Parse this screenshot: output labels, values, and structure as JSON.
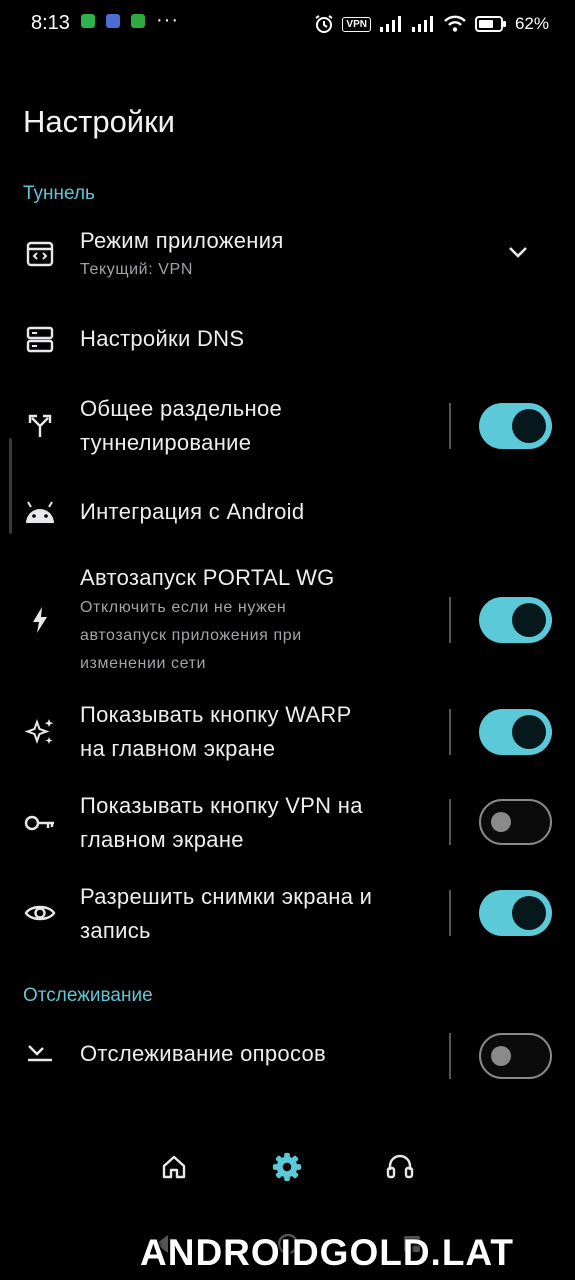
{
  "status_bar": {
    "time": "8:13",
    "dots": "···",
    "vpn_label": "VPN",
    "battery_percent": "62%",
    "icons": [
      "whatsapp-icon",
      "app-icon",
      "app-icon",
      "alarm-icon",
      "vpn-icon",
      "signal-icon",
      "signal-icon",
      "wifi-icon",
      "battery-icon"
    ]
  },
  "header": {
    "title": "Настройки"
  },
  "sections": {
    "tunnel": "Туннель",
    "tracking": "Отслеживание"
  },
  "rows": {
    "app_mode": {
      "title": "Режим приложения",
      "subtitle": "Текущий: VPN",
      "icon": "app-window-code-icon"
    },
    "dns": {
      "title": "Настройки DNS",
      "icon": "dns-servers-icon"
    },
    "split": {
      "title_line1": "Общее раздельное",
      "title_line2": "туннелирование",
      "icon": "fork-arrows-icon",
      "enabled": true
    },
    "android": {
      "title": "Интеграция с Android",
      "icon": "android-icon"
    },
    "autostart": {
      "title": "Автозапуск PORTAL WG",
      "sub_line1": "Отключить если не нужен",
      "sub_line2": "автозапуск приложения при",
      "sub_line3": "изменении сети",
      "icon": "bolt-icon",
      "enabled": true
    },
    "warp": {
      "title_line1": "Показывать кнопку WARP",
      "title_line2": "на главном экране",
      "icon": "sparkles-icon",
      "enabled": true
    },
    "vpn_button": {
      "title_line1": "Показывать кнопку VPN на",
      "title_line2": "главном экране",
      "icon": "key-icon",
      "enabled": false
    },
    "screenshots": {
      "title_line1": "Разрешить снимки экрана и",
      "title_line2": "запись",
      "icon": "eye-icon",
      "enabled": true
    },
    "ping_tracking": {
      "title": "Отслеживание опросов",
      "icon": "ping-icon",
      "enabled": false
    }
  },
  "bottom_nav": [
    "home-icon",
    "settings-gear-icon",
    "headset-icon"
  ],
  "watermark": "ANDROIDGOLD.LAT",
  "colors": {
    "accent": "#5cc9d9",
    "background": "#000000",
    "section": "#5ec6d6"
  }
}
